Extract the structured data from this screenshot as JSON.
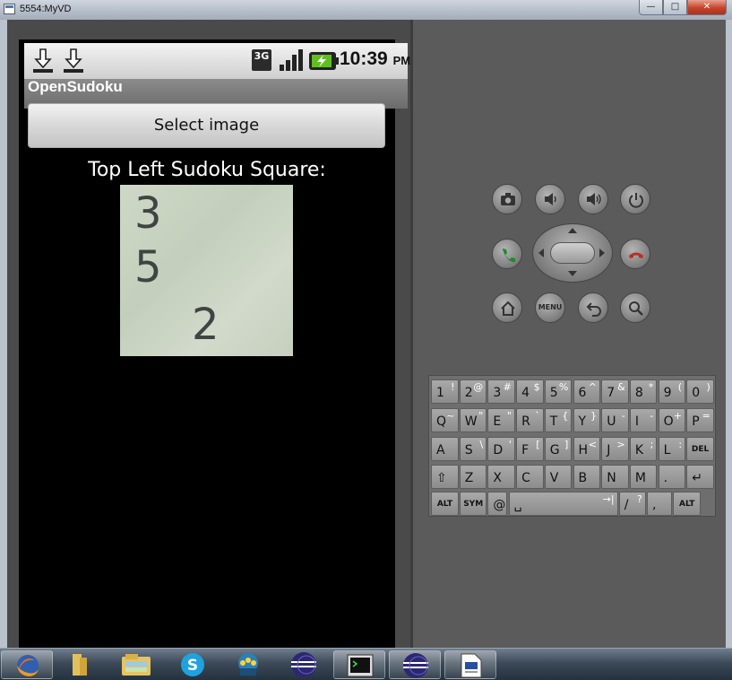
{
  "window": {
    "title": "5554:MyVD",
    "minimize_label": "—",
    "maximize_label": "□",
    "close_label": "✕"
  },
  "statusbar": {
    "network_label": "3G",
    "clock": "10:39",
    "ampm": "PM",
    "icons": [
      "download-icon",
      "download-icon",
      "3g-icon",
      "signal-icon",
      "battery-charging-icon"
    ]
  },
  "app": {
    "title": "OpenSudoku",
    "select_button_label": "Select image",
    "heading": "Top Left Sudoku Square:",
    "sudoku_digits": [
      "3",
      "5",
      "2"
    ]
  },
  "hardware_buttons": {
    "menu_label": "MENU",
    "icons": [
      "camera-icon",
      "volume-down-icon",
      "volume-up-icon",
      "power-icon",
      "call-icon",
      "dpad",
      "end-call-icon",
      "home-icon",
      "menu-button",
      "back-icon",
      "search-icon"
    ]
  },
  "keyboard": {
    "rows": [
      [
        [
          "1",
          "!"
        ],
        [
          "2",
          "@"
        ],
        [
          "3",
          "#"
        ],
        [
          "4",
          "$"
        ],
        [
          "5",
          "%"
        ],
        [
          "6",
          "^"
        ],
        [
          "7",
          "&"
        ],
        [
          "8",
          "*"
        ],
        [
          "9",
          "("
        ],
        [
          "0",
          ")"
        ]
      ],
      [
        [
          "Q",
          "~"
        ],
        [
          "W",
          "\""
        ],
        [
          "E",
          "\""
        ],
        [
          "R",
          "`"
        ],
        [
          "T",
          "{"
        ],
        [
          "Y",
          "}"
        ],
        [
          "U",
          "-"
        ],
        [
          "I",
          "-"
        ],
        [
          "O",
          "+"
        ],
        [
          "P",
          "="
        ]
      ],
      [
        [
          "A",
          ""
        ],
        [
          "S",
          "\\"
        ],
        [
          "D",
          "'"
        ],
        [
          "F",
          "["
        ],
        [
          "G",
          "]"
        ],
        [
          "H",
          "<"
        ],
        [
          "J",
          ">"
        ],
        [
          "K",
          ";"
        ],
        [
          "L",
          ":"
        ],
        [
          "DEL",
          ""
        ]
      ],
      [
        [
          "⇧",
          ""
        ],
        [
          "Z",
          ""
        ],
        [
          "X",
          ""
        ],
        [
          "C",
          ""
        ],
        [
          "V",
          ""
        ],
        [
          "B",
          ""
        ],
        [
          "N",
          ""
        ],
        [
          "M",
          ""
        ],
        [
          ".",
          ""
        ],
        [
          "↵",
          ""
        ]
      ],
      [
        [
          "ALT",
          ""
        ],
        [
          "SYM",
          ""
        ],
        [
          "@",
          ""
        ],
        [
          "␣",
          "→|"
        ],
        [
          "/",
          "?"
        ],
        [
          ",",
          ""
        ],
        [
          "ALT",
          ""
        ]
      ]
    ]
  },
  "taskbar": {
    "items": [
      "firefox-icon",
      "folder-icon",
      "file-explorer-icon",
      "skype-icon",
      "network-icon",
      "eclipse-icon",
      "terminal-icon",
      "eclipse-icon",
      "document-icon"
    ]
  }
}
